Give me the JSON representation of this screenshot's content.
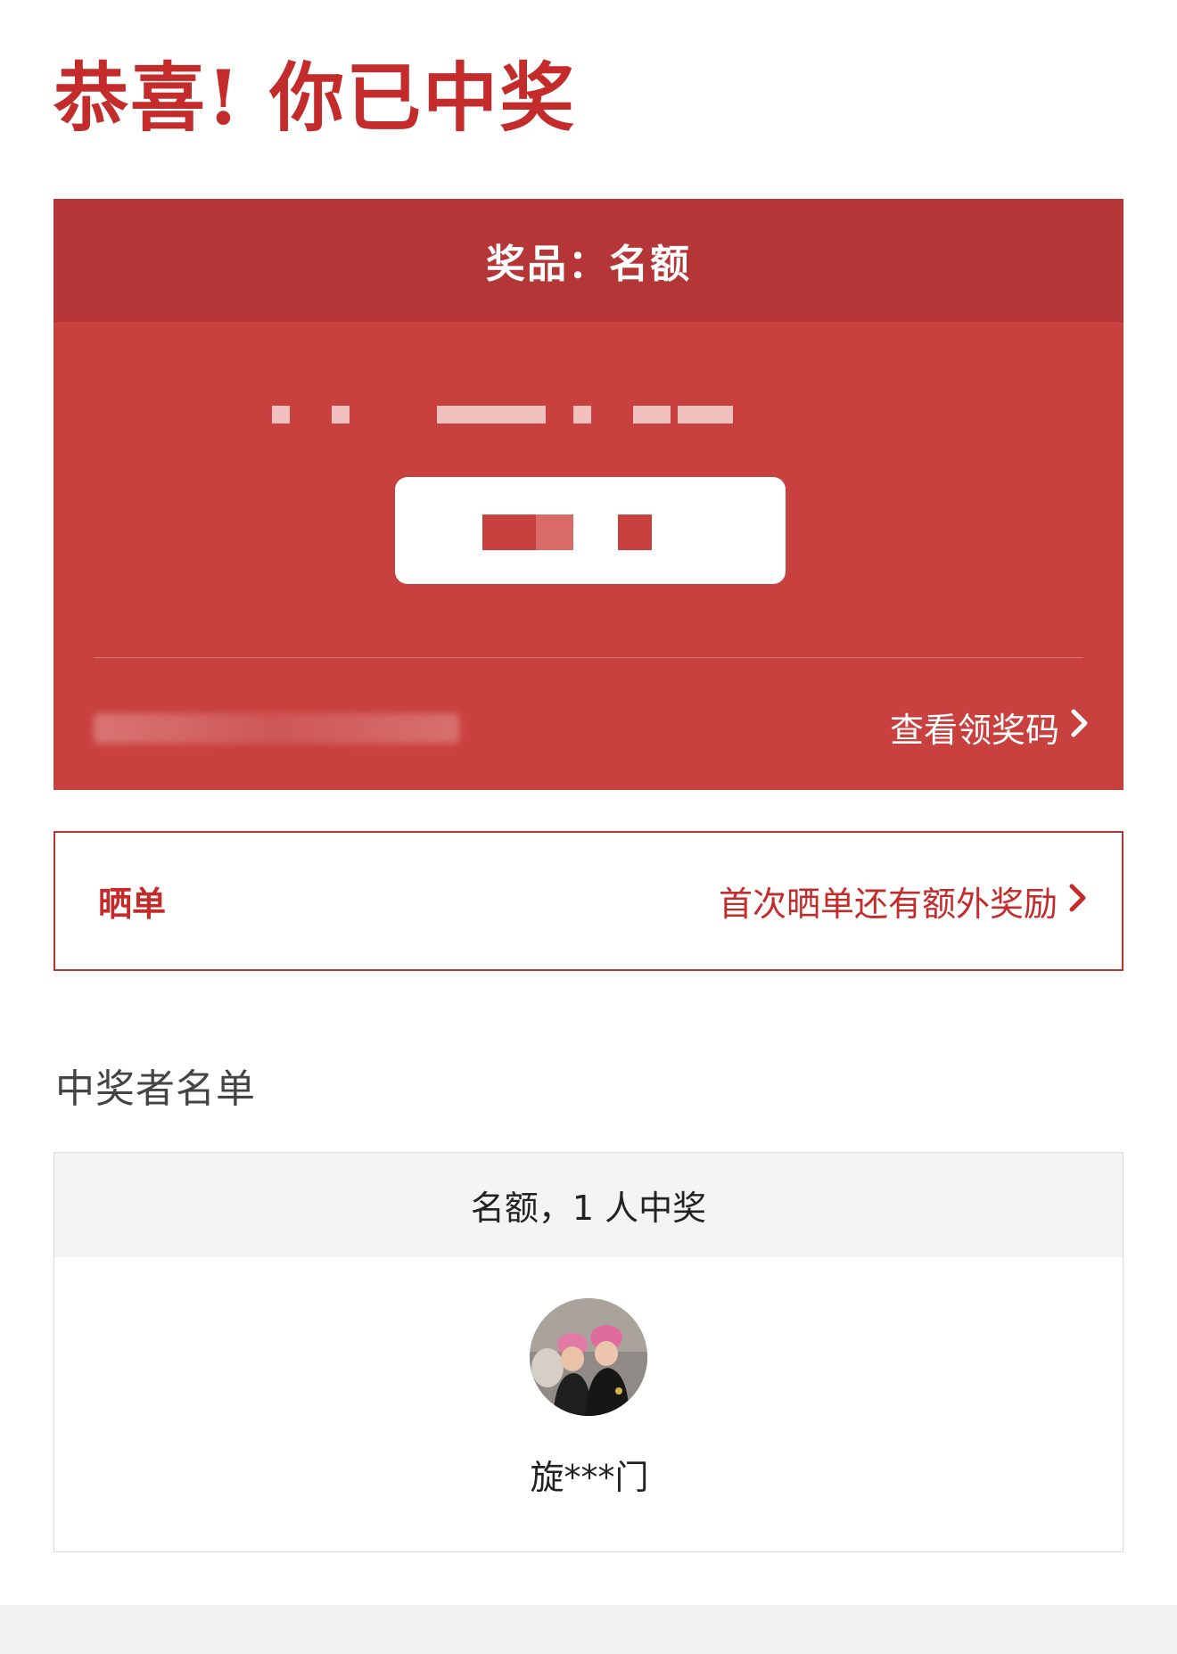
{
  "headline": "恭喜! 你已中奖",
  "prize_card": {
    "header": "奖品：名额",
    "view_code_label": "查看领奖码"
  },
  "share_card": {
    "title": "晒单",
    "hint": "首次晒单还有额外奖励"
  },
  "winners": {
    "section_title": "中奖者名单",
    "summary": "名额，1 人中奖",
    "list": [
      {
        "name": "旋***门"
      }
    ]
  },
  "colors": {
    "accent_red": "#c42b2b",
    "card_red": "#c9413f",
    "card_header_red": "#b53637"
  },
  "icons": {
    "chevron": "chevron-right-icon"
  }
}
